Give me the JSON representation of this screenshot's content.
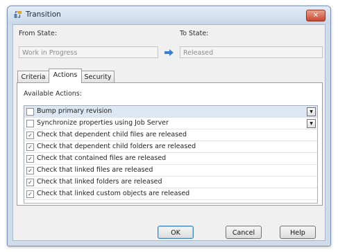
{
  "window": {
    "title": "Transition",
    "icon": "transition-icon",
    "close_icon": "close-icon",
    "close_label": "✕"
  },
  "form": {
    "from_state_label": "From State:",
    "from_state_value": "Work in Progress",
    "to_state_label": "To State:",
    "to_state_value": "Released",
    "arrow_icon": "right-arrow-icon"
  },
  "tabs": [
    {
      "label": "Criteria",
      "active": false
    },
    {
      "label": "Actions",
      "active": true
    },
    {
      "label": "Security",
      "active": false
    }
  ],
  "actions": {
    "heading": "Available Actions:",
    "items": [
      {
        "label": "Bump primary revision",
        "checked": false,
        "has_dropdown": true,
        "selected": true
      },
      {
        "label": "Synchronize properties using Job Server",
        "checked": false,
        "has_dropdown": true,
        "selected": false
      },
      {
        "label": "Check that dependent child files are released",
        "checked": true,
        "has_dropdown": false,
        "selected": false
      },
      {
        "label": "Check that dependent child folders are released",
        "checked": true,
        "has_dropdown": false,
        "selected": false
      },
      {
        "label": "Check that contained files are released",
        "checked": true,
        "has_dropdown": false,
        "selected": false
      },
      {
        "label": "Check that linked files are released",
        "checked": true,
        "has_dropdown": false,
        "selected": false
      },
      {
        "label": "Check that linked folders are released",
        "checked": true,
        "has_dropdown": false,
        "selected": false
      },
      {
        "label": "Check that linked custom objects are released",
        "checked": true,
        "has_dropdown": false,
        "selected": false
      }
    ]
  },
  "buttons": {
    "ok": "OK",
    "cancel": "Cancel",
    "help": "Help"
  },
  "colors": {
    "title_bar": "#c8d8ea",
    "close_button": "#c9472e",
    "selected_row": "#dde7f3",
    "arrow": "#3a7fd1"
  }
}
